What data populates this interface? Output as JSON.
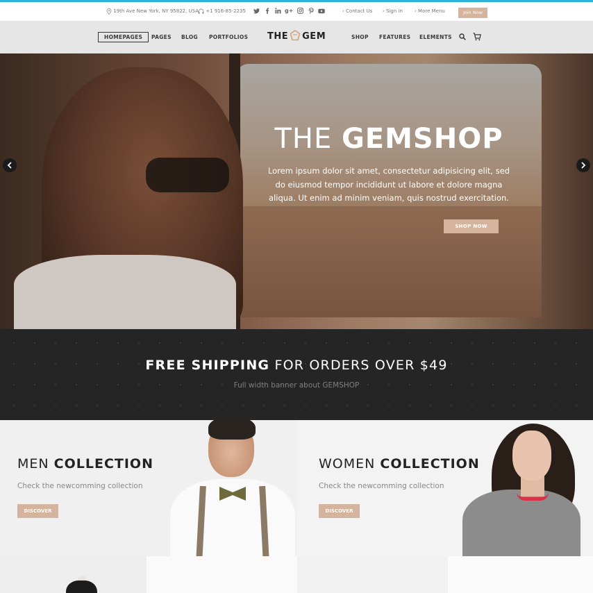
{
  "topbar": {
    "address": "19th Ave New York, NY 95822, USA",
    "phone": "+1 916-85-2235",
    "social_icons": [
      "twitter-icon",
      "facebook-icon",
      "linkedin-icon",
      "google-plus-icon",
      "instagram-icon",
      "pinterest-icon",
      "youtube-icon"
    ],
    "links": [
      "Contact Us",
      "Sign in",
      "More Menu"
    ],
    "join_button": "Join Now"
  },
  "nav": {
    "left_items": [
      "HOMEPAGES",
      "PAGES",
      "BLOG",
      "PORTFOLIOS"
    ],
    "logo_left": "THE",
    "logo_right": "GEM",
    "right_items": [
      "SHOP",
      "FEATURES",
      "ELEMENTS"
    ]
  },
  "hero": {
    "title_thin": "THE ",
    "title_bold": "GEMSHOP",
    "text": "Lorem ipsum dolor sit amet, consectetur adipisicing elit, sed do eiusmod tempor incididunt ut labore et dolore magna aliqua. Ut enim ad minim veniam, quis nostrud exercitation.",
    "button": "SHOP NOW"
  },
  "banner": {
    "title_bold": "FREE SHIPPING",
    "title_rest": " FOR ORDERS OVER $49",
    "subtitle": "Full width banner about GEMSHOP"
  },
  "collections": [
    {
      "title_thin": "MEN ",
      "title_bold": "COLLECTION",
      "subtitle": "Check the newcomming collection",
      "button": "DISCOVER"
    },
    {
      "title_thin": "WOMEN ",
      "title_bold": "COLLECTION",
      "subtitle": "Check the newcomming collection",
      "button": "DISCOVER"
    }
  ],
  "colors": {
    "accent_line": "#2bb3d8",
    "button_beige": "#d4b49c",
    "banner_bg": "#252525"
  }
}
